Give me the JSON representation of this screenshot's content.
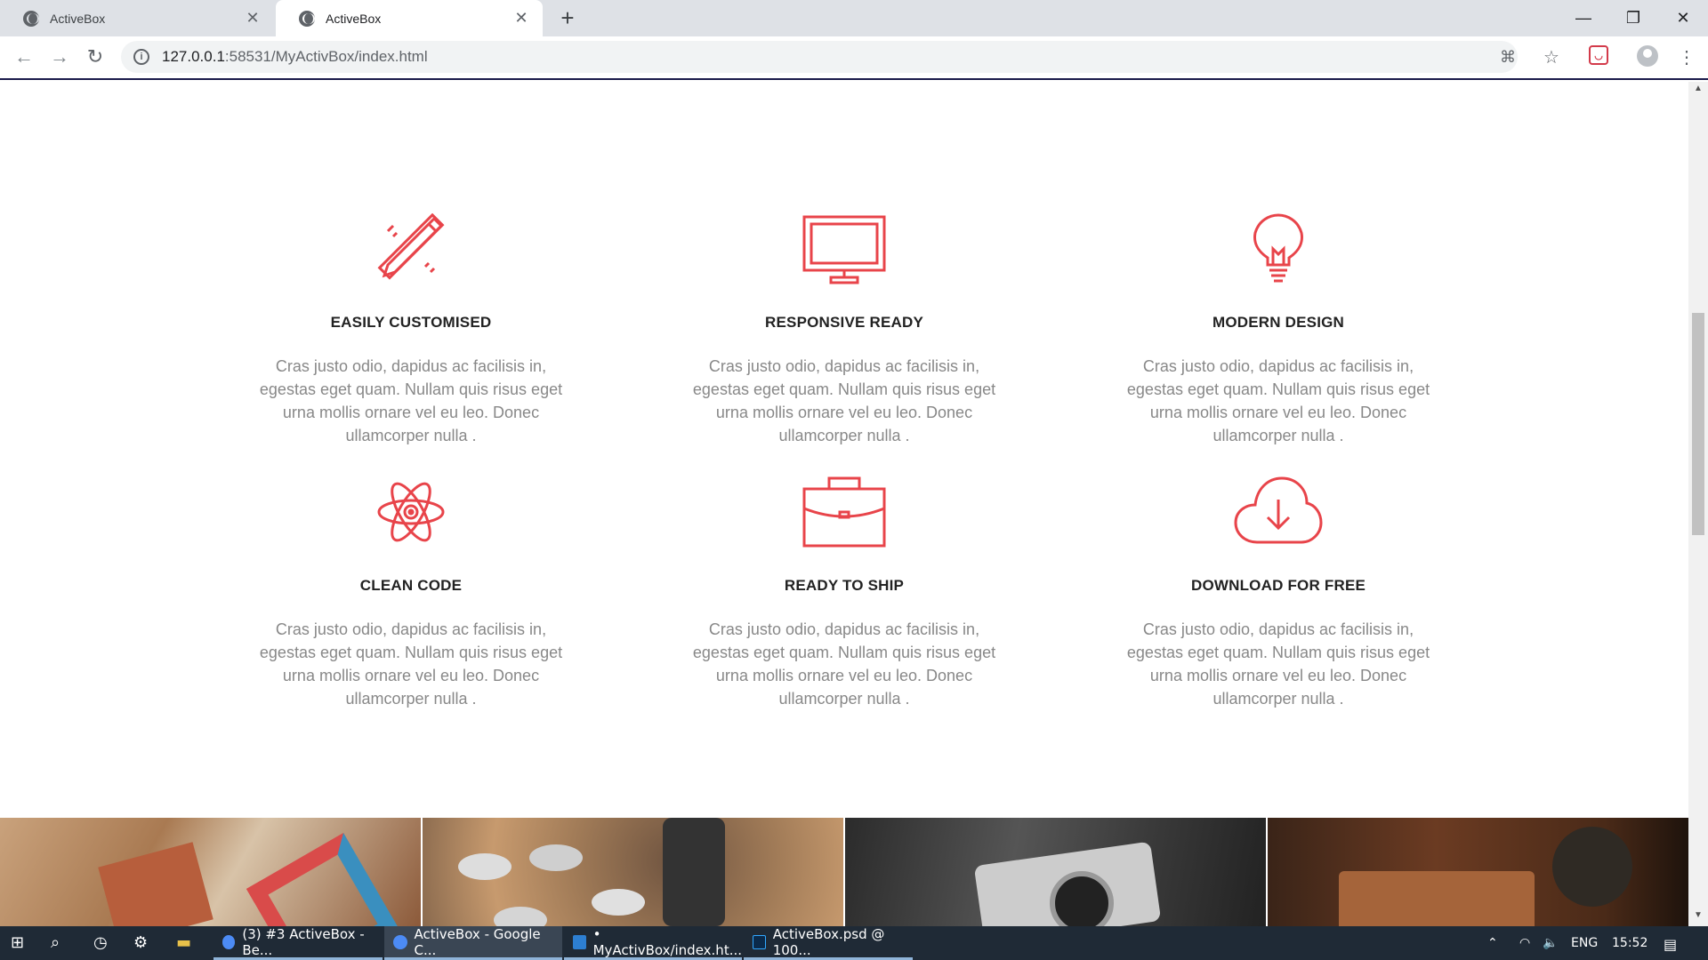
{
  "browser": {
    "tabs": [
      {
        "title": "ActiveBox"
      },
      {
        "title": "ActiveBox"
      }
    ],
    "address": {
      "host": "127.0.0.1",
      "path": ":58531/MyActivBox/index.html"
    }
  },
  "features": [
    {
      "title": "EASILY CUSTOMISED",
      "text": "Cras justo odio, dapidus ac facilisis in, egestas eget quam. Nullam quis risus eget urna mollis ornare vel eu leo. Donec ullamcorper nulla .",
      "icon": "pencil-ruler-icon"
    },
    {
      "title": "RESPONSIVE READY",
      "text": "Cras justo odio, dapidus ac facilisis in, egestas eget quam. Nullam quis risus eget urna mollis ornare vel eu leo. Donec ullamcorper nulla .",
      "icon": "monitor-icon"
    },
    {
      "title": "MODERN DESIGN",
      "text": "Cras justo odio, dapidus ac facilisis in, egestas eget quam. Nullam quis risus eget urna mollis ornare vel eu leo. Donec ullamcorper nulla .",
      "icon": "lightbulb-icon"
    },
    {
      "title": "CLEAN CODE",
      "text": "Cras justo odio, dapidus ac facilisis in, egestas eget quam. Nullam quis risus eget urna mollis ornare vel eu leo. Donec ullamcorper nulla .",
      "icon": "atom-icon"
    },
    {
      "title": "READY TO SHIP",
      "text": "Cras justo odio, dapidus ac facilisis in, egestas eget quam. Nullam quis risus eget urna mollis ornare vel eu leo. Donec ullamcorper nulla .",
      "icon": "briefcase-icon"
    },
    {
      "title": "DOWNLOAD FOR FREE",
      "text": "Cras justo odio, dapidus ac facilisis in, egestas eget quam. Nullam quis risus eget urna mollis ornare vel eu leo. Donec ullamcorper nulla .",
      "icon": "cloud-download-icon"
    }
  ],
  "colors": {
    "accent": "#e8444a"
  },
  "taskbar": {
    "apps": [
      {
        "label": "(3) #3 ActiveBox - Be..."
      },
      {
        "label": "ActiveBox - Google C..."
      },
      {
        "label": "• MyActivBox/index.ht..."
      },
      {
        "label": "ActiveBox.psd @ 100..."
      }
    ],
    "lang": "ENG",
    "time": "15:52"
  }
}
